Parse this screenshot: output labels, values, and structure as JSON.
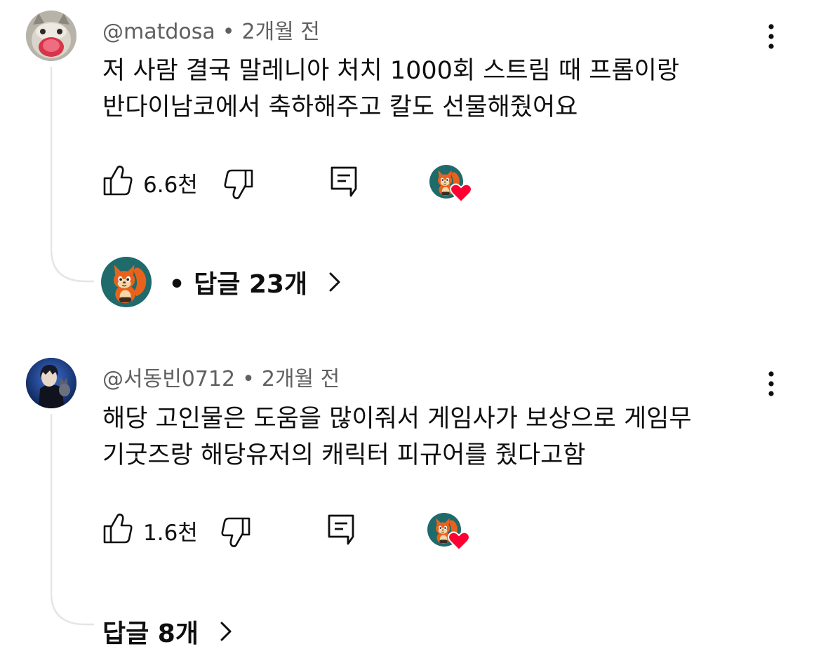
{
  "comments": [
    {
      "author": "@matdosa",
      "time": "2개월 전",
      "text_line1": "저 사람 결국 말레니아 처치 1000회 스트림 때 프롬이랑",
      "text_line2": "반다이남코에서 축하해주고 칼도 선물해줬어요",
      "likes": "6.6천",
      "replies_label": "• 답글 23개",
      "avatar_icon": "cat-avatar-icon"
    },
    {
      "author": "@서동빈0712",
      "time": "2개월 전",
      "text_line1": "해당 고인물은 도움을 많이줘서 게임사가 보상으로 게임무",
      "text_line2": "기굿즈랑 해당유저의 캐릭터 피규어를 줬다고함",
      "likes": "1.6천",
      "replies_label": "답글 8개",
      "avatar_icon": "anime-character-avatar-icon"
    }
  ],
  "meta_separator": "•",
  "colors": {
    "heart": "#ff0033",
    "creator_avatar_bg": "#1f6a6b",
    "squirrel": "#e8621c",
    "thread_line": "#e5e5e5",
    "secondary_text": "#606060"
  }
}
